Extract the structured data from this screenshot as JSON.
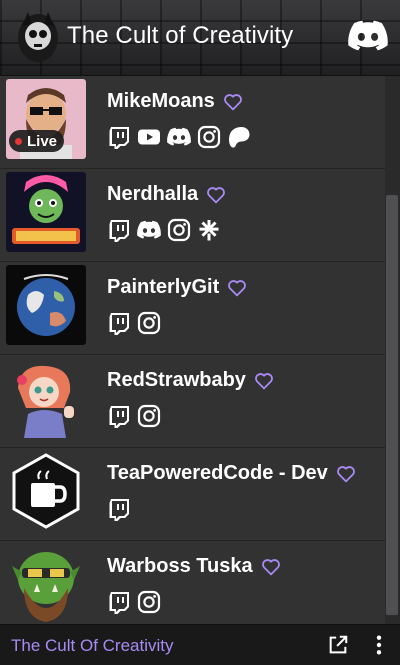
{
  "header": {
    "title": "The Cult of Creativity",
    "logo_icon": "cult-logo-icon",
    "discord_icon": "discord-icon"
  },
  "accent_color": "#a78af2",
  "members": [
    {
      "name": "MikeMoans",
      "live": true,
      "live_label": "Live",
      "socials": [
        "twitch",
        "youtube",
        "discord",
        "instagram",
        "patreon"
      ]
    },
    {
      "name": "Nerdhalla",
      "live": false,
      "socials": [
        "twitch",
        "discord",
        "instagram",
        "linktree"
      ]
    },
    {
      "name": "PainterlyGit",
      "live": false,
      "socials": [
        "twitch",
        "instagram"
      ]
    },
    {
      "name": "RedStrawbaby",
      "live": false,
      "socials": [
        "twitch",
        "instagram"
      ]
    },
    {
      "name": "TeaPoweredCode - Dev",
      "live": false,
      "socials": [
        "twitch"
      ]
    },
    {
      "name": "Warboss Tuska",
      "live": false,
      "socials": [
        "twitch",
        "instagram"
      ]
    }
  ],
  "footer": {
    "title": "The Cult Of Creativity",
    "popout_icon": "external-link-icon",
    "menu_icon": "more-vertical-icon"
  }
}
